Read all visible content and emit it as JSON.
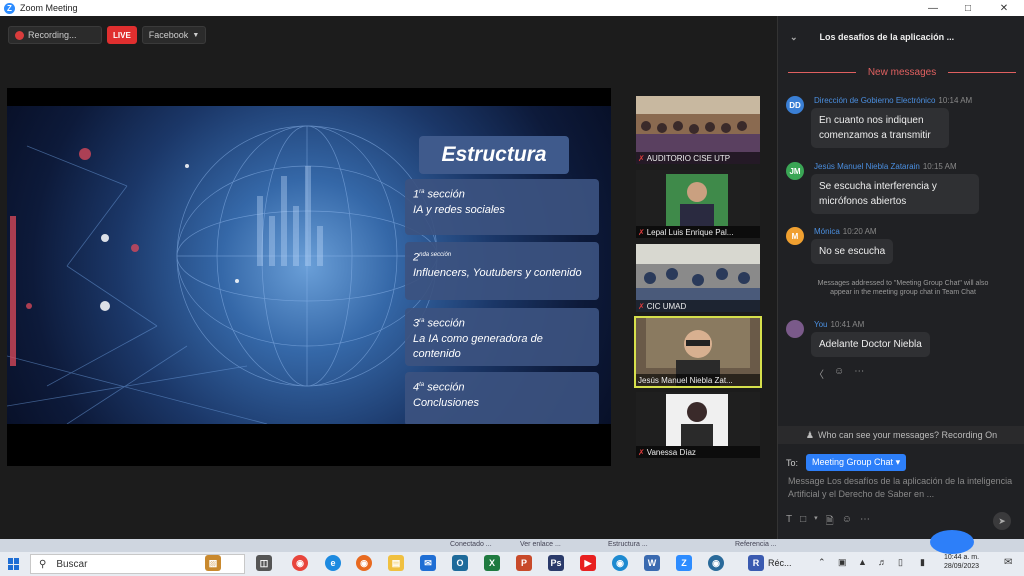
{
  "window": {
    "title": "Zoom Meeting"
  },
  "toolbar": {
    "recording": "Recording...",
    "live": "LIVE",
    "facebook": "Facebook"
  },
  "slide": {
    "title": "Estructura",
    "sections": [
      {
        "num": "1",
        "sup": "ra",
        "word": "sección",
        "text": "IA y redes sociales"
      },
      {
        "num": "2",
        "sup": "nda sección",
        "word": "",
        "text": "Influencers, Youtubers y contenido"
      },
      {
        "num": "3",
        "sup": "ra",
        "word": "sección",
        "text": "La IA como generadora de contenido"
      },
      {
        "num": "4",
        "sup": "ta",
        "word": "sección",
        "text": "Conclusiones"
      }
    ]
  },
  "participants": [
    {
      "name": "AUDITORIO CISE UTP"
    },
    {
      "name": "Lepal Luis Enrique Pal..."
    },
    {
      "name": "CIC UMAD"
    },
    {
      "name": "Jesús Manuel Niebla Zat..."
    },
    {
      "name": "Vanessa Díaz"
    }
  ],
  "chat": {
    "header": "Los desafíos de la aplicación ...",
    "new_messages": "New messages",
    "messages": [
      {
        "initials": "DD",
        "color": "#3a7fd5",
        "sender": "Dirección de Gobierno Electrónico",
        "time": "10:14 AM",
        "text": "En cuanto nos indiquen comenzamos a transmitir"
      },
      {
        "initials": "JM",
        "color": "#3aa655",
        "sender": "Jesús Manuel Niebla Zatarain",
        "time": "10:15 AM",
        "text": "Se escucha interferencia y micrófonos abiertos"
      },
      {
        "initials": "M",
        "color": "#f0a030",
        "sender": "Mónica",
        "time": "10:20 AM",
        "text": "No se escucha"
      },
      {
        "initials": "",
        "color": "#7a5a8a",
        "sender": "You",
        "time": "10:41 AM",
        "text": "Adelante Doctor Niebla"
      }
    ],
    "system_note": "Messages addressed to \"Meeting Group Chat\" will also appear in the meeting group chat in Team Chat",
    "who_can_see": "Who can see your messages? Recording On",
    "to_label": "To:",
    "recipient": "Meeting Group Chat",
    "compose_placeholder": "Message Los desafíos de la aplicación de la inteligencia Artificial y el Derecho de Saber en ..."
  },
  "taskbar": {
    "search_placeholder": "Buscar",
    "clock_time": "10:44 a. m.",
    "clock_date": "28/09/2023",
    "app_label": "Réc...",
    "strip_items": [
      "Conectado ...",
      "Ver enlace ...",
      "Estructura ...",
      "Referencia ..."
    ]
  }
}
